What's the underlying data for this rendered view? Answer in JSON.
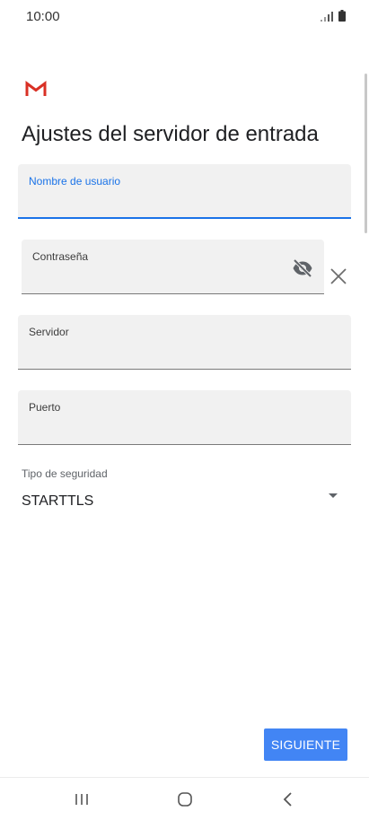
{
  "status_bar": {
    "time": "10:00",
    "signal_icon": "signal-icon",
    "battery_icon": "battery-icon"
  },
  "header": {
    "logo_icon": "gmail-logo-icon",
    "title": "Ajustes del servidor de entrada"
  },
  "form": {
    "username": {
      "label": "Nombre de usuario",
      "value": "",
      "focused": true
    },
    "password": {
      "label": "Contraseña",
      "value": "",
      "visibility_icon": "eye-off-icon",
      "clear_icon": "close-icon"
    },
    "server": {
      "label": "Servidor",
      "value": ""
    },
    "port": {
      "label": "Puerto",
      "value": ""
    },
    "security": {
      "label": "Tipo de seguridad",
      "selected": "STARTTLS"
    }
  },
  "actions": {
    "next_label": "SIGUIENTE"
  },
  "nav_bar": {
    "recents_icon": "recent-apps-icon",
    "home_icon": "home-icon",
    "back_icon": "back-icon"
  },
  "colors": {
    "accent": "#1a73e8",
    "button": "#4285f4",
    "field_bg": "#f1f1f1",
    "gmail_red": "#d93025"
  }
}
